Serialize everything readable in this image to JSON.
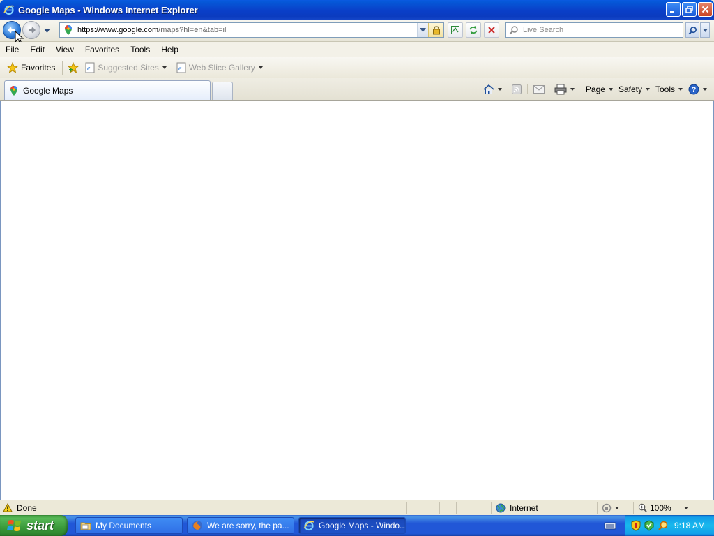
{
  "window": {
    "title": "Google Maps - Windows Internet Explorer"
  },
  "addressbar": {
    "url_host": "https://www.google.com",
    "url_path": "/maps?hl=en&tab=il"
  },
  "search": {
    "placeholder": "Live Search"
  },
  "menu": {
    "items": [
      "File",
      "Edit",
      "View",
      "Favorites",
      "Tools",
      "Help"
    ]
  },
  "favoritesbar": {
    "favorites_label": "Favorites",
    "links": [
      "Suggested Sites",
      "Web Slice Gallery"
    ]
  },
  "tabs": {
    "active_label": "Google Maps"
  },
  "commandbar": {
    "page_label": "Page",
    "safety_label": "Safety",
    "tools_label": "Tools"
  },
  "status": {
    "text": "Done",
    "zone": "Internet",
    "zoom": "100%"
  },
  "taskbar": {
    "start_label": "start",
    "buttons": [
      "My Documents",
      "We are sorry, the pa...",
      "Google Maps - Windo..."
    ],
    "clock": "9:18 AM"
  },
  "colors": {
    "titlebar": "#0a3fc8",
    "taskbar": "#2157d7",
    "start": "#3a9a3a",
    "content": "#ffffff"
  }
}
